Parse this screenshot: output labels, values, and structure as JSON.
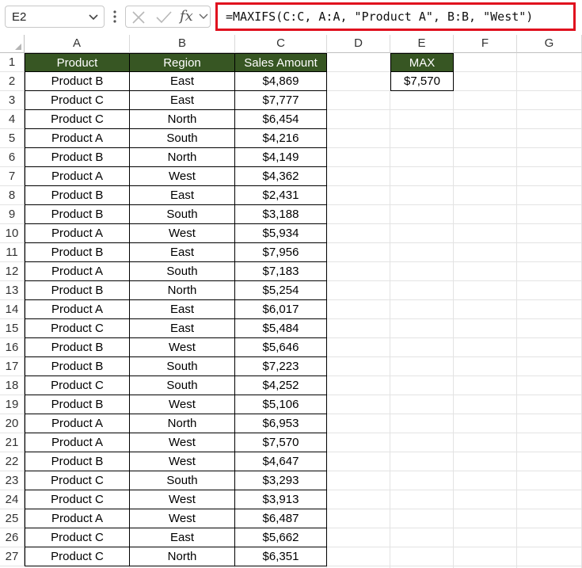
{
  "formula_bar": {
    "name_box": "E2",
    "fx_label": "fx",
    "formula": "=MAXIFS(C:C, A:A, \"Product A\", B:B, \"West\")"
  },
  "columns": [
    "A",
    "B",
    "C",
    "D",
    "E",
    "F",
    "G"
  ],
  "rows": [
    "1",
    "2",
    "3",
    "4",
    "5",
    "6",
    "7",
    "8",
    "9",
    "10",
    "11",
    "12",
    "13",
    "14",
    "15",
    "16",
    "17",
    "18",
    "19",
    "20",
    "21",
    "22",
    "23",
    "24",
    "25",
    "26",
    "27"
  ],
  "table": {
    "headers": [
      "Product",
      "Region",
      "Sales Amount"
    ],
    "rows": [
      [
        "Product B",
        "East",
        "$4,869"
      ],
      [
        "Product C",
        "East",
        "$7,777"
      ],
      [
        "Product C",
        "North",
        "$6,454"
      ],
      [
        "Product A",
        "South",
        "$4,216"
      ],
      [
        "Product B",
        "North",
        "$4,149"
      ],
      [
        "Product A",
        "West",
        "$4,362"
      ],
      [
        "Product B",
        "East",
        "$2,431"
      ],
      [
        "Product B",
        "South",
        "$3,188"
      ],
      [
        "Product A",
        "West",
        "$5,934"
      ],
      [
        "Product B",
        "East",
        "$7,956"
      ],
      [
        "Product A",
        "South",
        "$7,183"
      ],
      [
        "Product B",
        "North",
        "$5,254"
      ],
      [
        "Product A",
        "East",
        "$6,017"
      ],
      [
        "Product C",
        "East",
        "$5,484"
      ],
      [
        "Product B",
        "West",
        "$5,646"
      ],
      [
        "Product B",
        "South",
        "$7,223"
      ],
      [
        "Product C",
        "South",
        "$4,252"
      ],
      [
        "Product B",
        "West",
        "$5,106"
      ],
      [
        "Product A",
        "North",
        "$6,953"
      ],
      [
        "Product A",
        "West",
        "$7,570"
      ],
      [
        "Product B",
        "West",
        "$4,647"
      ],
      [
        "Product C",
        "South",
        "$3,293"
      ],
      [
        "Product C",
        "West",
        "$3,913"
      ],
      [
        "Product A",
        "West",
        "$6,487"
      ],
      [
        "Product C",
        "East",
        "$5,662"
      ],
      [
        "Product C",
        "North",
        "$6,351"
      ]
    ]
  },
  "max_box": {
    "header": "MAX",
    "value": "$7,570"
  },
  "colors": {
    "header_fill": "#375623",
    "formula_highlight": "#e0101e"
  }
}
